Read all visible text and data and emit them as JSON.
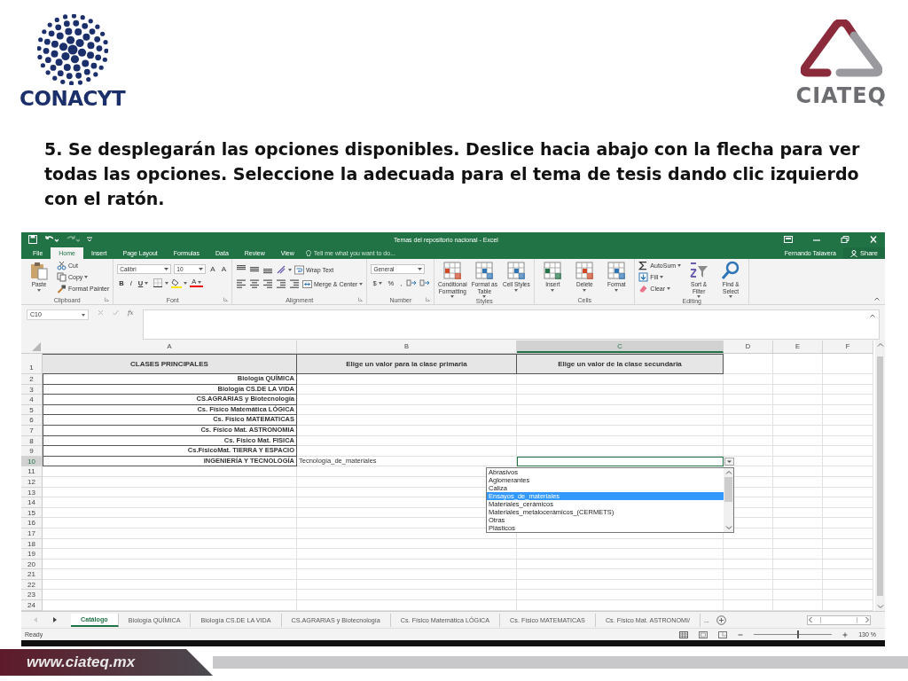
{
  "slide": {
    "logo_left": "CONACYT",
    "logo_right": "CIATEQ",
    "instruction": "5. Se desplegarán las opciones disponibles. Deslice hacia abajo con la flecha para ver todas las opciones. Seleccione la adecuada para el tema de tesis dando clic izquierdo con el ratón.",
    "footer": "www.ciateq.mx"
  },
  "window": {
    "title": "Temas del repositorio nacional - Excel",
    "user": "Fernando Talavera",
    "share": "Share"
  },
  "menu_tabs": [
    {
      "label": "File",
      "selected": false
    },
    {
      "label": "Home",
      "selected": true
    },
    {
      "label": "Insert",
      "selected": false
    },
    {
      "label": "Page Layout",
      "selected": false
    },
    {
      "label": "Formulas",
      "selected": false
    },
    {
      "label": "Data",
      "selected": false
    },
    {
      "label": "Review",
      "selected": false
    },
    {
      "label": "View",
      "selected": false
    }
  ],
  "tell_me": {
    "placeholder": "Tell me what you want to do..."
  },
  "ribbon": [
    {
      "label": "Clipboard",
      "launcher": true,
      "stacks": [
        [
          {
            "kind": "paste",
            "label": "Paste"
          }
        ],
        [
          {
            "kind": "cut",
            "label": "Cut"
          },
          {
            "kind": "copy",
            "label": "Copy"
          },
          {
            "kind": "painter",
            "label": "Format Painter"
          }
        ]
      ]
    },
    {
      "label": "Font",
      "launcher": true,
      "lines": [
        [
          {
            "kind": "font",
            "value": "Calibri"
          },
          {
            "kind": "size",
            "value": "10"
          },
          {
            "kind": "grow",
            "text": "A"
          },
          {
            "kind": "shrink",
            "text": "A"
          }
        ],
        [
          {
            "kind": "bold",
            "text": "B"
          },
          {
            "kind": "italic",
            "text": "I"
          },
          {
            "kind": "underline",
            "text": "U"
          },
          {
            "kind": "borders"
          },
          {
            "kind": "fill"
          },
          {
            "kind": "fontcolor",
            "text": "A"
          }
        ]
      ]
    },
    {
      "label": "Alignment",
      "launcher": true,
      "lines": [
        [
          {
            "kind": "aligntop"
          },
          {
            "kind": "alignmid"
          },
          {
            "kind": "alignbot"
          },
          {
            "kind": "orient"
          },
          {
            "kind": "wrap",
            "label": "Wrap Text"
          }
        ],
        [
          {
            "kind": "alignleft"
          },
          {
            "kind": "aligncenter"
          },
          {
            "kind": "alignright"
          },
          {
            "kind": "outdent"
          },
          {
            "kind": "indent"
          },
          {
            "kind": "merge",
            "label": "Merge & Center"
          }
        ]
      ]
    },
    {
      "label": "Number",
      "launcher": true,
      "lines": [
        [
          {
            "kind": "format",
            "value": "General"
          }
        ],
        [
          {
            "kind": "currency",
            "text": "$"
          },
          {
            "kind": "percent",
            "text": "%"
          },
          {
            "kind": "comma",
            "text": ","
          },
          {
            "kind": "incdec"
          },
          {
            "kind": "decdec"
          }
        ]
      ]
    },
    {
      "label": "Styles",
      "launcher": false,
      "stacks": [
        [
          {
            "kind": "condfmt",
            "label": "Conditional Formatting"
          }
        ],
        [
          {
            "kind": "astable",
            "label": "Format as Table"
          }
        ],
        [
          {
            "kind": "cellstyles",
            "label": "Cell Styles"
          }
        ]
      ]
    },
    {
      "label": "Cells",
      "launcher": false,
      "stacks": [
        [
          {
            "kind": "insert",
            "label": "Insert"
          }
        ],
        [
          {
            "kind": "delete",
            "label": "Delete"
          }
        ],
        [
          {
            "kind": "cellformat",
            "label": "Format"
          }
        ]
      ]
    },
    {
      "label": "Editing",
      "launcher": false,
      "stacks": [
        [
          {
            "kind": "autosum",
            "label": "AutoSum"
          },
          {
            "kind": "fillcmd",
            "label": "Fill"
          },
          {
            "kind": "clear",
            "label": "Clear"
          }
        ],
        [
          {
            "kind": "sort",
            "label": "Sort & Filter"
          }
        ],
        [
          {
            "kind": "find",
            "label": "Find & Select"
          }
        ]
      ]
    }
  ],
  "formula_bar": {
    "name_box": "C10",
    "function_label": "fx"
  },
  "columns": [
    {
      "label": "A",
      "selected": false
    },
    {
      "label": "B",
      "selected": false
    },
    {
      "label": "C",
      "selected": true
    },
    {
      "label": "D",
      "selected": false
    },
    {
      "label": "E",
      "selected": false
    },
    {
      "label": "F",
      "selected": false
    }
  ],
  "rows": [
    {
      "number": "1",
      "kind": "header",
      "selected": false,
      "cells": [
        "CLASES PRINCIPALES",
        "Elige un valor para la clase primaria",
        "Elige un valor de la clase secundaria"
      ]
    },
    {
      "number": "2",
      "kind": "data",
      "selected": false,
      "cells": [
        "Biología QUÍMICA"
      ]
    },
    {
      "number": "3",
      "kind": "data",
      "selected": false,
      "cells": [
        "Biología CS.DE LA VIDA"
      ]
    },
    {
      "number": "4",
      "kind": "data",
      "selected": false,
      "cells": [
        "CS.AGRARIAS y Biotecnología"
      ]
    },
    {
      "number": "5",
      "kind": "data",
      "selected": false,
      "cells": [
        "Cs. Físico Matemática LÓGICA"
      ]
    },
    {
      "number": "6",
      "kind": "data",
      "selected": false,
      "cells": [
        "Cs. Físico MATEMATICAS"
      ]
    },
    {
      "number": "7",
      "kind": "data",
      "selected": false,
      "cells": [
        "Cs. Físico Mat. ASTRONOMIA"
      ]
    },
    {
      "number": "8",
      "kind": "data",
      "selected": false,
      "cells": [
        "Cs. Físico Mat. FISICA"
      ]
    },
    {
      "number": "9",
      "kind": "data",
      "selected": false,
      "cells": [
        "Cs.FísicoMat. TIERRA Y ESPACIO"
      ]
    },
    {
      "number": "10",
      "kind": "data",
      "selected": true,
      "cells": [
        "INGENIERÍA Y TECNOLOGÍA",
        "Tecnología_de_materiales"
      ]
    },
    {
      "number": "11",
      "kind": "empty",
      "selected": false
    },
    {
      "number": "12",
      "kind": "empty",
      "selected": false
    },
    {
      "number": "13",
      "kind": "empty",
      "selected": false
    },
    {
      "number": "14",
      "kind": "empty",
      "selected": false
    },
    {
      "number": "15",
      "kind": "empty",
      "selected": false
    },
    {
      "number": "16",
      "kind": "empty",
      "selected": false
    },
    {
      "number": "17",
      "kind": "empty",
      "selected": false
    },
    {
      "number": "18",
      "kind": "empty",
      "selected": false
    },
    {
      "number": "19",
      "kind": "empty",
      "selected": false
    },
    {
      "number": "20",
      "kind": "empty",
      "selected": false
    },
    {
      "number": "21",
      "kind": "empty",
      "selected": false
    },
    {
      "number": "22",
      "kind": "empty",
      "selected": false
    },
    {
      "number": "23",
      "kind": "empty",
      "selected": false
    },
    {
      "number": "24",
      "kind": "empty",
      "selected": false
    }
  ],
  "dropdown": {
    "options": [
      {
        "label": "Abrasivos",
        "selected": false
      },
      {
        "label": "Aglomerantes",
        "selected": false
      },
      {
        "label": "Caliza",
        "selected": false
      },
      {
        "label": "Ensayos_de_materiales",
        "selected": true
      },
      {
        "label": "Materiales_cerámicos",
        "selected": false
      },
      {
        "label": "Materiales_metalocerámicos_(CERMETS)",
        "selected": false
      },
      {
        "label": "Otras",
        "selected": false
      },
      {
        "label": "Plásticos",
        "selected": false
      }
    ]
  },
  "sheet_tabs": [
    {
      "label": "Catálogo",
      "selected": true
    },
    {
      "label": "Biología QUÍMICA",
      "selected": false
    },
    {
      "label": "Biología CS.DE LA VIDA",
      "selected": false
    },
    {
      "label": "CS.AGRARIAS y Biotecnología",
      "selected": false
    },
    {
      "label": "Cs. Físico Matemática LÓGICA",
      "selected": false
    },
    {
      "label": "Cs. Físico MATEMATICAS",
      "selected": false
    },
    {
      "label": "Cs. Físico Mat. ASTRONOMI/",
      "selected": false
    }
  ],
  "more_tabs": "...",
  "status_bar": {
    "text": "Ready",
    "zoom": "130 %",
    "level": 0.55
  }
}
